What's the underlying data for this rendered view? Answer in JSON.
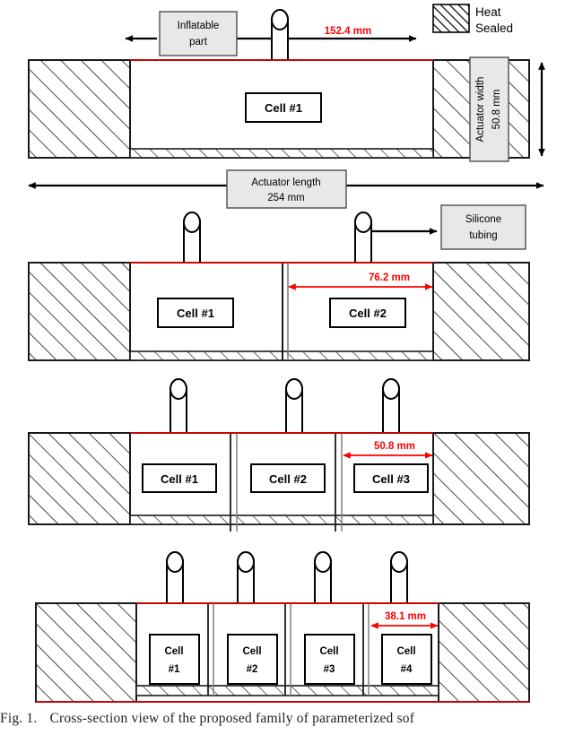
{
  "figure": {
    "caption_number": "Fig. 1.",
    "caption_text": "Cross-section view of the proposed family of parameterized sof",
    "colors": {
      "dimension_red": "#ff0000",
      "outline_black": "#000000",
      "label_box_fill": "#e8e8e8",
      "background": "#ffffff"
    }
  },
  "legend": {
    "swatch_name": "hatched-swatch",
    "line1": "Heat",
    "line2": "Sealed"
  },
  "callouts": {
    "inflatable_part": "Inflatable\npart",
    "inflatable_part_line1": "Inflatable",
    "inflatable_part_line2": "part",
    "actuator_length_line1": "Actuator length",
    "actuator_length_line2": "254 mm",
    "silicone_tubing_line1": "Silicone",
    "silicone_tubing_line2": "tubing",
    "actuator_width_line1": "Actuator width",
    "actuator_width_line2": "50.8 mm"
  },
  "panels": [
    {
      "id": "panel-1-cell",
      "cell_count": 1,
      "dimension_label": "152.4 mm",
      "cells": [
        {
          "label": "Cell #1",
          "line1": "Cell #1",
          "line2": ""
        }
      ]
    },
    {
      "id": "panel-2-cell",
      "cell_count": 2,
      "dimension_label": "76.2 mm",
      "cells": [
        {
          "label": "Cell #1",
          "line1": "Cell #1",
          "line2": ""
        },
        {
          "label": "Cell #2",
          "line1": "Cell #2",
          "line2": ""
        }
      ]
    },
    {
      "id": "panel-3-cell",
      "cell_count": 3,
      "dimension_label": "50.8 mm",
      "cells": [
        {
          "label": "Cell #1",
          "line1": "Cell #1",
          "line2": ""
        },
        {
          "label": "Cell #2",
          "line1": "Cell #2",
          "line2": ""
        },
        {
          "label": "Cell #3",
          "line1": "Cell #3",
          "line2": ""
        }
      ]
    },
    {
      "id": "panel-4-cell",
      "cell_count": 4,
      "dimension_label": "38.1 mm",
      "cells": [
        {
          "label": "Cell #1",
          "line1": "Cell",
          "line2": "#1"
        },
        {
          "label": "Cell #2",
          "line1": "Cell",
          "line2": "#2"
        },
        {
          "label": "Cell #3",
          "line1": "Cell",
          "line2": "#3"
        },
        {
          "label": "Cell #4",
          "line1": "Cell",
          "line2": "#4"
        }
      ]
    }
  ]
}
